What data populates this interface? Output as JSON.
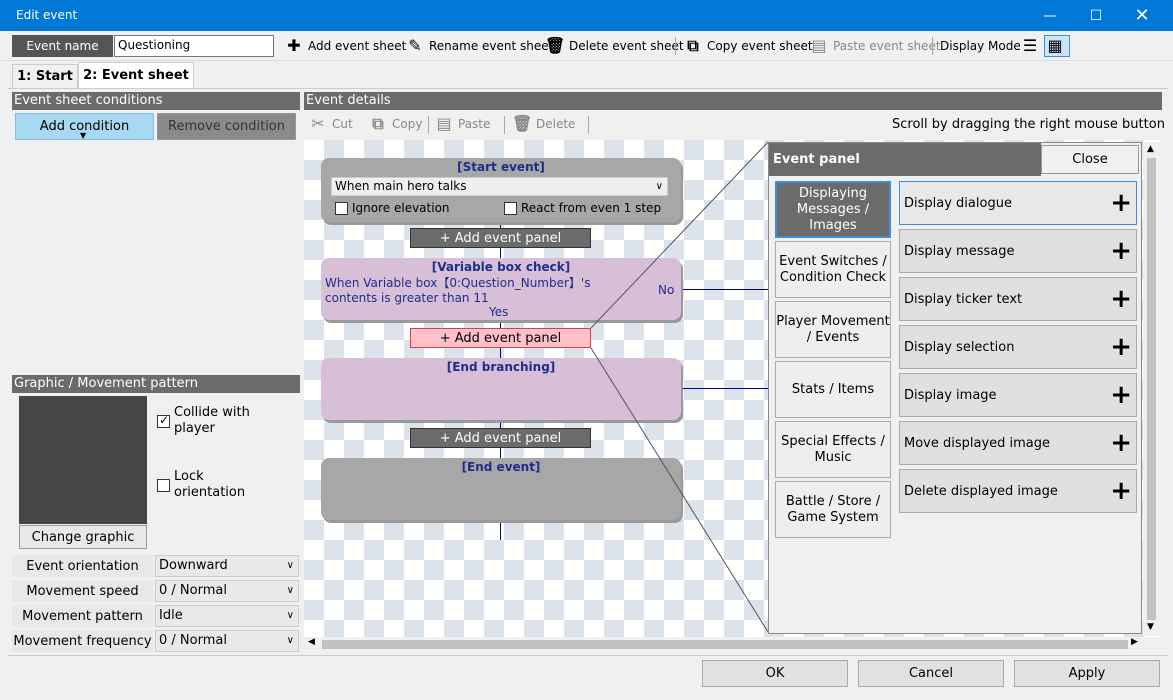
{
  "window": {
    "title": "Edit event",
    "minimize_icon": "minimize-icon",
    "maximize_icon": "maximize-icon",
    "close_icon": "close-icon"
  },
  "toolbar": {
    "event_name_label": "Event name",
    "event_name_value": "Questioning",
    "add_event_sheet": "Add event sheet",
    "rename_event_sheet": "Rename event sheet",
    "delete_event_sheet": "Delete event sheet",
    "copy_event_sheet": "Copy event sheet",
    "paste_event_sheet": "Paste event sheet",
    "display_mode": "Display Mode"
  },
  "tabs": [
    {
      "label": "1: Start",
      "active": false
    },
    {
      "label": "2: Event sheet",
      "active": true
    }
  ],
  "conditions": {
    "header": "Event sheet conditions",
    "add_condition": "Add condition",
    "remove_condition": "Remove condition"
  },
  "graphic": {
    "header": "Graphic / Movement pattern",
    "collide_label": "Collide  with player",
    "collide_checked": true,
    "lock_label": "Lock orientation",
    "lock_checked": false,
    "change_graphic": "Change graphic"
  },
  "properties": [
    {
      "label": "Event orientation",
      "value": "Downward"
    },
    {
      "label": "Movement speed",
      "value": "0 / Normal"
    },
    {
      "label": "Movement pattern",
      "value": "Idle"
    },
    {
      "label": "Movement frequency",
      "value": "0 / Normal"
    }
  ],
  "details": {
    "header": "Event details",
    "cut": "Cut",
    "copy": "Copy",
    "paste": "Paste",
    "delete": "Delete",
    "scroll_hint": "Scroll by dragging the right mouse button"
  },
  "flow": {
    "start_title": "[Start event]",
    "trigger_value": "When main hero talks",
    "ignore_elevation": "Ignore elevation",
    "react_step": "React from even 1 step",
    "add_panel": "+ Add event panel",
    "varcheck_title": "[Variable box check]",
    "varcheck_text": "When Variable box【0:Question_Number】's contents is greater than 11",
    "no_label": "No",
    "yes_label": "Yes",
    "end_branch_title": "[End branching]",
    "end_event_title": "[End event]"
  },
  "event_panel": {
    "title": "Event panel",
    "close": "Close",
    "categories": [
      "Displaying Messages / Images",
      "Event Switches / Condition Check",
      "Player Movement / Events",
      "Stats / Items",
      "Special Effects / Music",
      "Battle / Store / Game System"
    ],
    "commands": [
      "Display dialogue",
      "Display message",
      "Display ticker text",
      "Display selection",
      "Display image",
      "Move displayed image",
      "Delete displayed image"
    ]
  },
  "footer": {
    "ok": "OK",
    "cancel": "Cancel",
    "apply": "Apply"
  },
  "colors": {
    "titlebar": "#0078d7",
    "accent_blue": "#3c8fdb",
    "start_box": "#a7a7a7",
    "branch_box": "#d8bfd8",
    "add_panel_dark": "#6b6b6b",
    "add_panel_selected": "#ffc0cb"
  }
}
